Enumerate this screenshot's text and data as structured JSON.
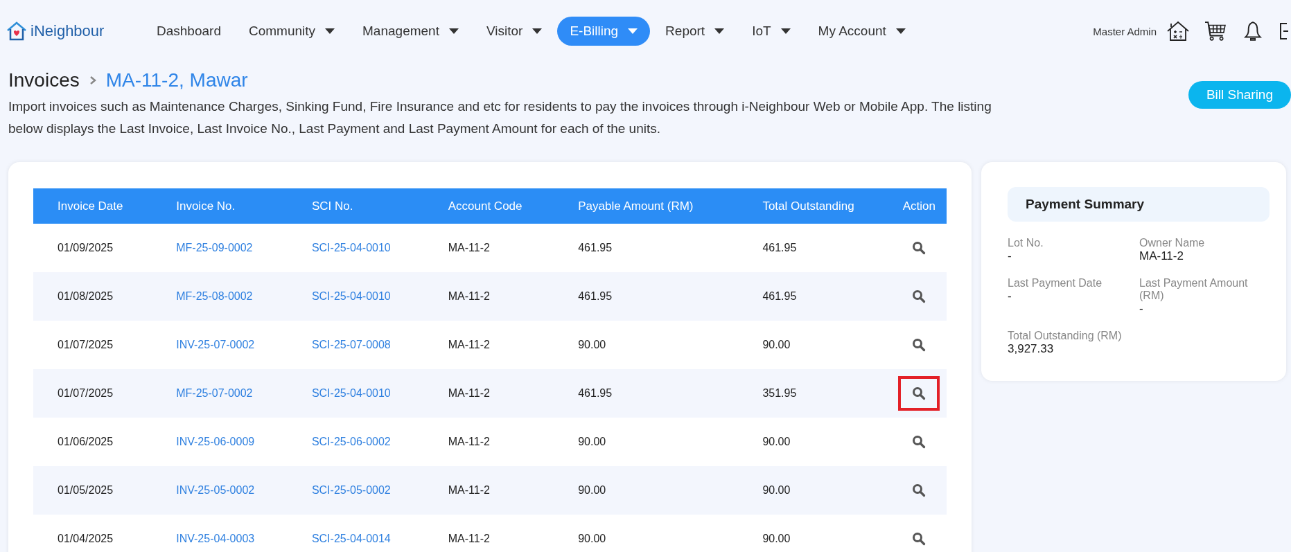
{
  "brand": "iNeighbour",
  "nav": [
    {
      "label": "Dashboard",
      "dropdown": false,
      "selected": false
    },
    {
      "label": "Community",
      "dropdown": true,
      "selected": false
    },
    {
      "label": "Management",
      "dropdown": true,
      "selected": false
    },
    {
      "label": "Visitor",
      "dropdown": true,
      "selected": false
    },
    {
      "label": "E-Billing",
      "dropdown": true,
      "selected": true
    },
    {
      "label": "Report",
      "dropdown": true,
      "selected": false
    },
    {
      "label": "IoT",
      "dropdown": true,
      "selected": false
    },
    {
      "label": "My Account",
      "dropdown": true,
      "selected": false
    }
  ],
  "user": "Master Admin",
  "breadcrumb": {
    "parent": "Invoices",
    "current": "MA-11-2, Mawar"
  },
  "bill_sharing_button": "Bill Sharing",
  "description": "Import invoices such as Maintenance Charges, Sinking Fund, Fire Insurance and etc for residents to pay the invoices through i-Neighbour Web or Mobile App. The listing below displays the Last Invoice, Last Invoice No., Last Payment and Last Payment Amount for each of the units.",
  "table": {
    "columns": [
      "Invoice Date",
      "Invoice No.",
      "SCI No.",
      "Account Code",
      "Payable Amount (RM)",
      "Total Outstanding",
      "Action"
    ],
    "rows": [
      {
        "date": "01/09/2025",
        "invoice_no": "MF-25-09-0002",
        "sci_no": "SCI-25-04-0010",
        "account_code": "MA-11-2",
        "payable": "461.95",
        "outstanding": "461.95",
        "highlighted": false
      },
      {
        "date": "01/08/2025",
        "invoice_no": "MF-25-08-0002",
        "sci_no": "SCI-25-04-0010",
        "account_code": "MA-11-2",
        "payable": "461.95",
        "outstanding": "461.95",
        "highlighted": false
      },
      {
        "date": "01/07/2025",
        "invoice_no": "INV-25-07-0002",
        "sci_no": "SCI-25-07-0008",
        "account_code": "MA-11-2",
        "payable": "90.00",
        "outstanding": "90.00",
        "highlighted": false
      },
      {
        "date": "01/07/2025",
        "invoice_no": "MF-25-07-0002",
        "sci_no": "SCI-25-04-0010",
        "account_code": "MA-11-2",
        "payable": "461.95",
        "outstanding": "351.95",
        "highlighted": true
      },
      {
        "date": "01/06/2025",
        "invoice_no": "INV-25-06-0009",
        "sci_no": "SCI-25-06-0002",
        "account_code": "MA-11-2",
        "payable": "90.00",
        "outstanding": "90.00",
        "highlighted": false
      },
      {
        "date": "01/05/2025",
        "invoice_no": "INV-25-05-0002",
        "sci_no": "SCI-25-05-0002",
        "account_code": "MA-11-2",
        "payable": "90.00",
        "outstanding": "90.00",
        "highlighted": false
      },
      {
        "date": "01/04/2025",
        "invoice_no": "INV-25-04-0003",
        "sci_no": "SCI-25-04-0014",
        "account_code": "MA-11-2",
        "payable": "90.00",
        "outstanding": "90.00",
        "highlighted": false
      }
    ]
  },
  "payment_summary": {
    "title": "Payment Summary",
    "fields": [
      {
        "label": "Lot No.",
        "value": "-"
      },
      {
        "label": "Owner Name",
        "value": "MA-11-2"
      },
      {
        "label": "Last Payment Date",
        "value": "-"
      },
      {
        "label": "Last Payment Amount (RM)",
        "value": "-"
      },
      {
        "label": "Total Outstanding (RM)",
        "value": "3,927.33"
      }
    ]
  }
}
